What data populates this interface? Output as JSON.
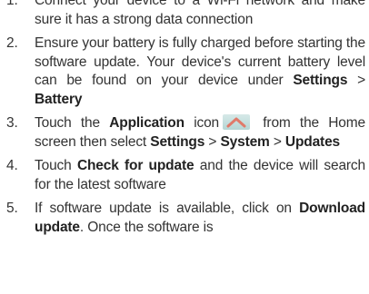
{
  "steps": [
    {
      "num": "1.",
      "text": "Connect your device to a Wi-Fi network and make sure it has a strong data connection"
    },
    {
      "num": "2.",
      "text_a": "Ensure your battery is fully charged before starting the software update. Your device's current battery level can be found on your device under ",
      "bold_a": "Settings",
      "sep": " > ",
      "bold_b": "Battery"
    },
    {
      "num": "3.",
      "text_a": "Touch the ",
      "bold_a": "Application",
      "text_b": " icon",
      "icon_name": "application-chevron-up-icon",
      "text_c": " from the Home screen then select ",
      "bold_b": "Settings",
      "sep_a": " > ",
      "bold_c": "System",
      "sep_b": " > ",
      "bold_d": "Updates"
    },
    {
      "num": "4.",
      "text_a": "Touch ",
      "bold_a": "Check for update",
      "text_b": " and the device will search for the latest software"
    },
    {
      "num": "5.",
      "text_a": "If software update is available, click on ",
      "bold_a": "Download update",
      "text_b": ". Once the software is"
    }
  ],
  "colors": {
    "text": "#333333",
    "icon_bg_top": "#d6e9e8",
    "icon_bg_bottom": "#b5d6d4",
    "icon_chevron": "#e07a6a"
  }
}
